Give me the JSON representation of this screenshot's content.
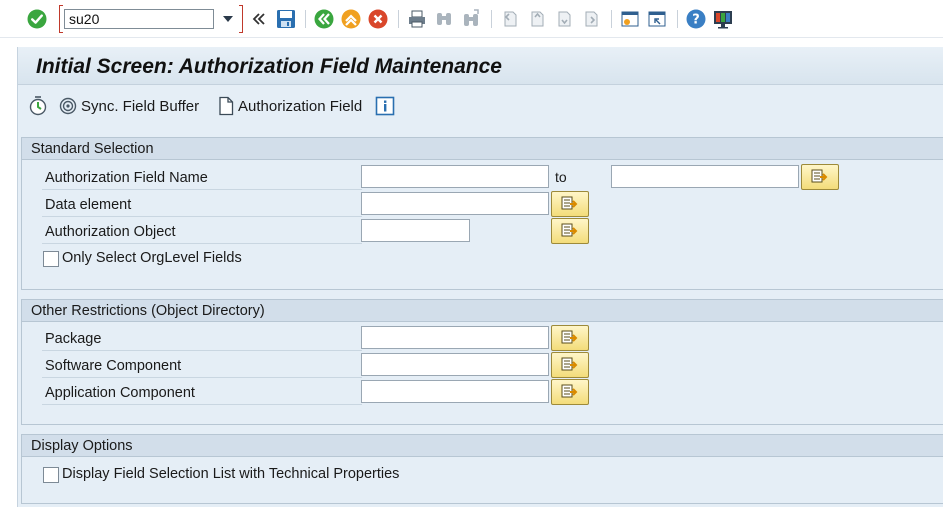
{
  "system_toolbar": {
    "command_field": {
      "value": "su20",
      "placeholder": ""
    },
    "icons": [
      "enter-icon",
      "command-field-collapse-icon",
      "save-icon",
      "back-icon",
      "exit-icon",
      "cancel-icon",
      "print-icon",
      "find-icon",
      "find-next-icon",
      "first-page-icon",
      "previous-page-icon",
      "next-page-icon",
      "last-page-icon",
      "create-session-icon",
      "create-shortcut-icon",
      "help-icon",
      "customize-layout-icon"
    ]
  },
  "title": "Initial Screen: Authorization Field Maintenance",
  "app_toolbar": {
    "execute_icon": "execute-icon",
    "sync_label": "Sync. Field Buffer",
    "auth_field_label": "Authorization Field",
    "info_icon": "information-icon"
  },
  "standard_selection": {
    "title": "Standard Selection",
    "auth_field_name": {
      "label": "Authorization Field Name",
      "from": "",
      "to": "",
      "to_label": "to"
    },
    "data_element": {
      "label": "Data element",
      "value": ""
    },
    "auth_object": {
      "label": "Authorization Object",
      "value": ""
    },
    "only_orglevel": {
      "label": "Only Select OrgLevel Fields",
      "checked": false
    }
  },
  "other_restrictions": {
    "title": "Other Restrictions (Object Directory)",
    "package": {
      "label": "Package",
      "value": ""
    },
    "software_component": {
      "label": "Software Component",
      "value": ""
    },
    "application_component": {
      "label": "Application Component",
      "value": ""
    }
  },
  "display_options": {
    "title": "Display Options",
    "tech_props": {
      "label": "Display Field Selection List with Technical Properties",
      "checked": false
    }
  },
  "colors": {
    "panel_background": "#e5eef6",
    "group_header": "#d2deea",
    "multi_select_button": "#f3dc7a",
    "command_field_focus": "#c0392b",
    "enter_green": "#3aa63f"
  }
}
